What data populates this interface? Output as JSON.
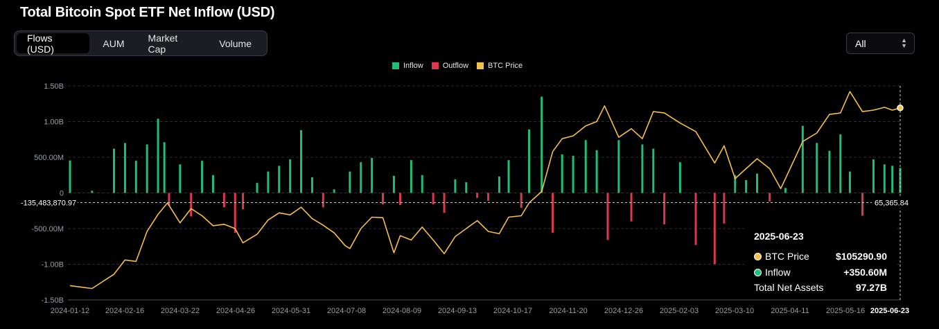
{
  "title": "Total Bitcoin Spot ETF Net Inflow (USD)",
  "tabs": [
    {
      "label": "Flows (USD)",
      "active": true
    },
    {
      "label": "AUM",
      "active": false
    },
    {
      "label": "Market Cap",
      "active": false
    },
    {
      "label": "Volume",
      "active": false
    }
  ],
  "range_select": {
    "value": "All"
  },
  "colors": {
    "inflow": "#1fbf75",
    "outflow": "#e0364f",
    "btc_price": "#f5c04a",
    "background": "#000000",
    "grid": "#2a2d33",
    "axis_text": "#9a9ea6"
  },
  "legend": [
    {
      "label": "Inflow",
      "color": "#1fbf75"
    },
    {
      "label": "Outflow",
      "color": "#e0364f"
    },
    {
      "label": "BTC Price",
      "color": "#f5c04a"
    }
  ],
  "crosshair": {
    "left_label": "-135,483,870.97",
    "right_label": "65,365.84",
    "value": -135483870.97
  },
  "tooltip": {
    "date": "2025-06-23",
    "rows": [
      {
        "label": "BTC Price",
        "value": "$105290.90",
        "color": "#f5c04a"
      },
      {
        "label": "Inflow",
        "value": "+350.60M",
        "color": "#1fbf75"
      },
      {
        "label": "Total Net Assets",
        "value": "97.27B"
      }
    ]
  },
  "chart_data": {
    "type": "bar",
    "title": "Total Bitcoin Spot ETF Net Inflow (USD)",
    "y_ticks": [
      "1.50B",
      "1.00B",
      "500.00M",
      "0",
      "-500.00M",
      "-1.00B",
      "-1.50B"
    ],
    "ylim": [
      -1500000000,
      1500000000
    ],
    "x_ticks": [
      "2024-01-12",
      "2024-02-16",
      "2024-03-22",
      "2024-04-26",
      "2024-05-31",
      "2024-07-08",
      "2024-08-09",
      "2024-09-13",
      "2024-10-17",
      "2024-11-20",
      "2024-12-26",
      "2025-02-03",
      "2025-03-10",
      "2025-04-11",
      "2025-05-16",
      "2025-06-23"
    ],
    "highlighted_x": "2025-06-23",
    "legend_position": "top-center",
    "grid": true,
    "series": [
      {
        "name": "Inflow / Outflow",
        "kind": "bar",
        "unit": "USD",
        "x": [
          "2024-01-12",
          "2024-01-26",
          "2024-02-09",
          "2024-02-16",
          "2024-02-23",
          "2024-03-01",
          "2024-03-08",
          "2024-03-12",
          "2024-03-15",
          "2024-03-22",
          "2024-03-29",
          "2024-04-05",
          "2024-04-12",
          "2024-04-19",
          "2024-04-26",
          "2024-05-01",
          "2024-05-10",
          "2024-05-17",
          "2024-05-24",
          "2024-05-31",
          "2024-06-07",
          "2024-06-14",
          "2024-06-21",
          "2024-06-28",
          "2024-07-08",
          "2024-07-15",
          "2024-07-22",
          "2024-07-29",
          "2024-08-05",
          "2024-08-09",
          "2024-08-16",
          "2024-08-23",
          "2024-08-30",
          "2024-09-06",
          "2024-09-13",
          "2024-09-20",
          "2024-09-27",
          "2024-10-04",
          "2024-10-11",
          "2024-10-17",
          "2024-10-25",
          "2024-10-30",
          "2024-11-07",
          "2024-11-14",
          "2024-11-20",
          "2024-11-27",
          "2024-12-05",
          "2024-12-12",
          "2024-12-19",
          "2024-12-26",
          "2025-01-03",
          "2025-01-10",
          "2025-01-17",
          "2025-01-24",
          "2025-02-03",
          "2025-02-13",
          "2025-02-25",
          "2025-03-03",
          "2025-03-10",
          "2025-03-17",
          "2025-03-24",
          "2025-04-01",
          "2025-04-11",
          "2025-04-22",
          "2025-05-01",
          "2025-05-09",
          "2025-05-16",
          "2025-05-22",
          "2025-05-30",
          "2025-06-06",
          "2025-06-13",
          "2025-06-18",
          "2025-06-23"
        ],
        "values": [
          455000000,
          30000000,
          620000000,
          700000000,
          450000000,
          680000000,
          1040000000,
          710000000,
          -180000000,
          400000000,
          -330000000,
          450000000,
          250000000,
          -200000000,
          -560000000,
          -230000000,
          140000000,
          300000000,
          380000000,
          470000000,
          880000000,
          220000000,
          -200000000,
          50000000,
          300000000,
          430000000,
          490000000,
          -160000000,
          240000000,
          -170000000,
          460000000,
          250000000,
          -160000000,
          -280000000,
          190000000,
          150000000,
          -70000000,
          -110000000,
          230000000,
          460000000,
          -210000000,
          890000000,
          1350000000,
          -560000000,
          540000000,
          520000000,
          740000000,
          600000000,
          -660000000,
          740000000,
          -400000000,
          680000000,
          620000000,
          -440000000,
          430000000,
          -730000000,
          -1000000000,
          -430000000,
          250000000,
          180000000,
          270000000,
          -120000000,
          70000000,
          940000000,
          700000000,
          590000000,
          820000000,
          300000000,
          -320000000,
          470000000,
          400000000,
          380000000,
          350600000
        ]
      },
      {
        "name": "BTC Price",
        "kind": "line",
        "unit": "USD",
        "x": [
          "2024-01-12",
          "2024-01-26",
          "2024-02-09",
          "2024-02-16",
          "2024-02-23",
          "2024-03-01",
          "2024-03-08",
          "2024-03-14",
          "2024-03-22",
          "2024-03-29",
          "2024-04-05",
          "2024-04-12",
          "2024-04-19",
          "2024-04-26",
          "2024-05-01",
          "2024-05-10",
          "2024-05-17",
          "2024-05-24",
          "2024-05-31",
          "2024-06-07",
          "2024-06-14",
          "2024-06-21",
          "2024-06-28",
          "2024-07-05",
          "2024-07-08",
          "2024-07-15",
          "2024-07-22",
          "2024-07-29",
          "2024-08-05",
          "2024-08-09",
          "2024-08-16",
          "2024-08-23",
          "2024-08-30",
          "2024-09-06",
          "2024-09-13",
          "2024-09-20",
          "2024-09-27",
          "2024-10-04",
          "2024-10-11",
          "2024-10-17",
          "2024-10-25",
          "2024-10-30",
          "2024-11-07",
          "2024-11-14",
          "2024-11-20",
          "2024-11-27",
          "2024-12-05",
          "2024-12-12",
          "2024-12-17",
          "2024-12-26",
          "2025-01-03",
          "2025-01-10",
          "2025-01-17",
          "2025-01-24",
          "2025-02-03",
          "2025-02-13",
          "2025-02-25",
          "2025-03-03",
          "2025-03-10",
          "2025-03-17",
          "2025-03-24",
          "2025-04-01",
          "2025-04-08",
          "2025-04-11",
          "2025-04-22",
          "2025-05-01",
          "2025-05-09",
          "2025-05-16",
          "2025-05-22",
          "2025-05-30",
          "2025-06-06",
          "2025-06-13",
          "2025-06-18",
          "2025-06-23"
        ],
        "values": [
          43000,
          42000,
          47000,
          52000,
          51500,
          62000,
          68000,
          72000,
          65000,
          70000,
          67500,
          64000,
          64500,
          63000,
          58000,
          61000,
          66000,
          68500,
          67800,
          70500,
          66500,
          64200,
          61500,
          57000,
          56000,
          63000,
          67000,
          66800,
          54500,
          60500,
          59000,
          63500,
          59000,
          54200,
          60200,
          63000,
          65800,
          62000,
          61200,
          67000,
          67500,
          72000,
          76000,
          90000,
          94500,
          95500,
          99000,
          100500,
          106000,
          95000,
          98000,
          94500,
          104000,
          103500,
          100000,
          97000,
          86000,
          92000,
          80500,
          84000,
          87500,
          84000,
          77000,
          80500,
          93500,
          96500,
          103000,
          103500,
          111000,
          104000,
          104500,
          105500,
          104500,
          105290.9
        ]
      }
    ]
  }
}
